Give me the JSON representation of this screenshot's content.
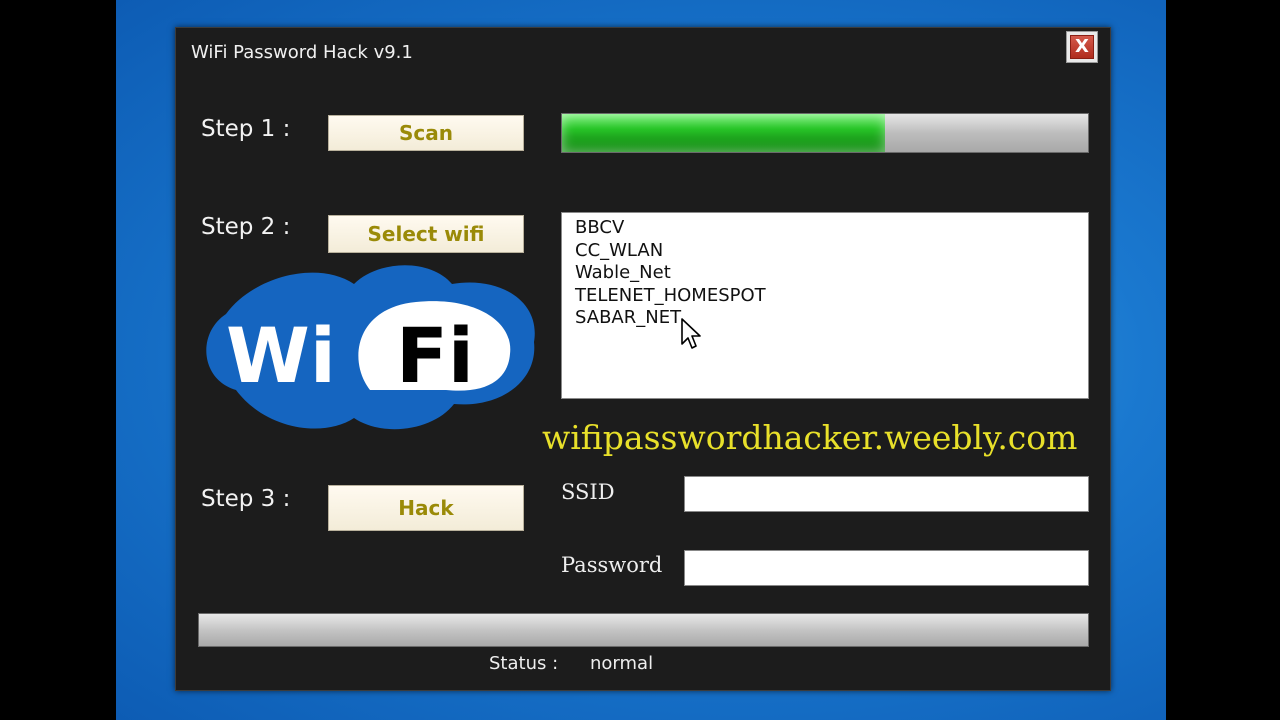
{
  "window": {
    "title": "WiFi Password Hack v9.1",
    "close_label": "X"
  },
  "steps": [
    {
      "label": "Step 1 :",
      "button": "Scan"
    },
    {
      "label": "Step 2 :",
      "button": "Select wifi"
    },
    {
      "label": "Step 3 :",
      "button": "Hack"
    }
  ],
  "scan_progress": 0.615,
  "networks": [
    "BBCV",
    "CC_WLAN",
    "Wable_Net",
    "TELENET_HOMESPOT",
    "SABAR_NET"
  ],
  "logo": {
    "text_left": "Wi",
    "text_right": "Fi"
  },
  "website": "wifipasswordhacker.weebly.com",
  "fields": {
    "ssid_label": "SSID",
    "ssid_value": "",
    "password_label": "Password",
    "password_value": ""
  },
  "hack_progress": 0,
  "status": {
    "label": "Status :",
    "value": "normal"
  },
  "colors": {
    "window_bg": "#1c1c1c",
    "button_text": "#9a8a08",
    "progress_green": "#27c427",
    "website_text": "#e8e02a",
    "logo_blue": "#1565c0"
  }
}
